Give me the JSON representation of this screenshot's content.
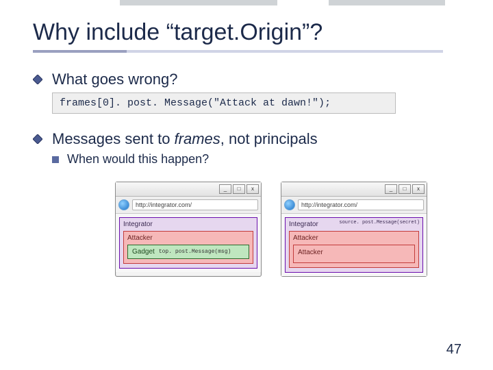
{
  "title": "Why include “target.Origin”?",
  "bullets": {
    "b1": "What goes wrong?",
    "code": "frames[0]. post. Message(\"Attack at dawn!\");",
    "b2_pre": "Messages sent to ",
    "b2_ital": "frames",
    "b2_post": ", not principals",
    "sub1": "When would this happen?"
  },
  "win": {
    "min": "_",
    "max": "□",
    "close": "x",
    "url": "http://integrator.com/",
    "integrator": "Integrator",
    "attacker": "Attacker",
    "gadget": "Gadget",
    "gadget_code": "top. post.Message(msg)",
    "src_code": "source. post.Message(secret)"
  },
  "pagenum": "47"
}
